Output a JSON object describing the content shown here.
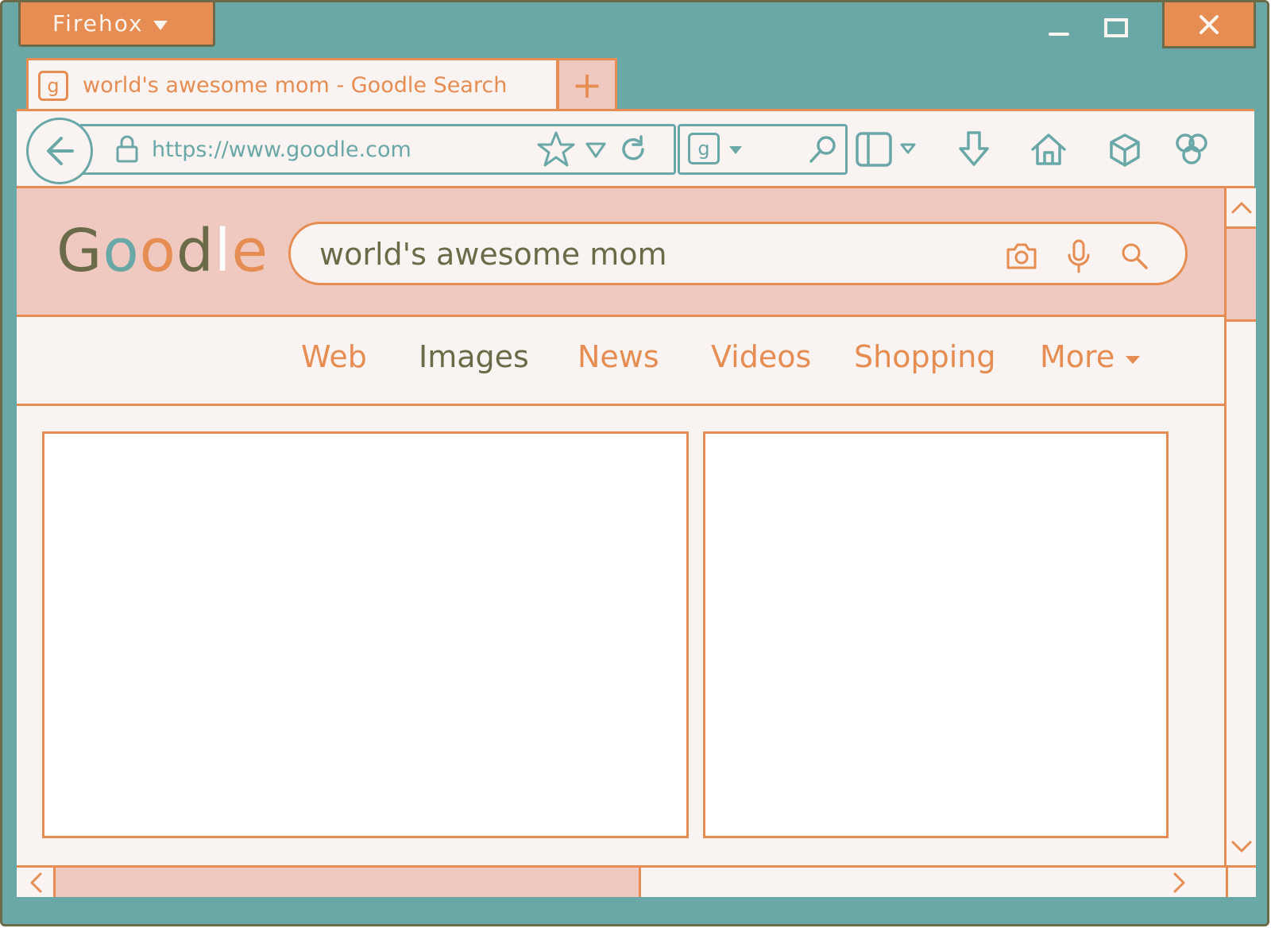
{
  "window": {
    "app_menu_label": "Firehox",
    "colors": {
      "frame": "#69a8a7",
      "accent": "#e58d52",
      "pink": "#efc9c0",
      "page": "#f9f3f1",
      "olive": "#6b6b4a"
    }
  },
  "tab": {
    "favicon": "g",
    "title": "world's awesome mom - Goodle Search",
    "new_tab_label": "+"
  },
  "toolbar": {
    "url": "https://www.goodle.com",
    "search_engine_icon": "g",
    "icons": [
      "back-arrow-icon",
      "lock-icon",
      "star-icon",
      "dropdown-icon",
      "reload-icon",
      "search-icon",
      "sidebar-icon",
      "download-icon",
      "home-icon",
      "cube-icon",
      "extensions-icon"
    ]
  },
  "page": {
    "logo": {
      "letters": [
        "G",
        "o",
        "o",
        "d",
        "l",
        "e"
      ],
      "colors": [
        "#6b6b4a",
        "#69a8a7",
        "#e58d52",
        "#6b6b4a",
        "#ffffff",
        "#e58d52"
      ]
    },
    "search_query": "world's awesome mom",
    "nav": [
      "Web",
      "Images",
      "News",
      "Videos",
      "Shopping",
      "More"
    ],
    "active_nav": "Images"
  }
}
